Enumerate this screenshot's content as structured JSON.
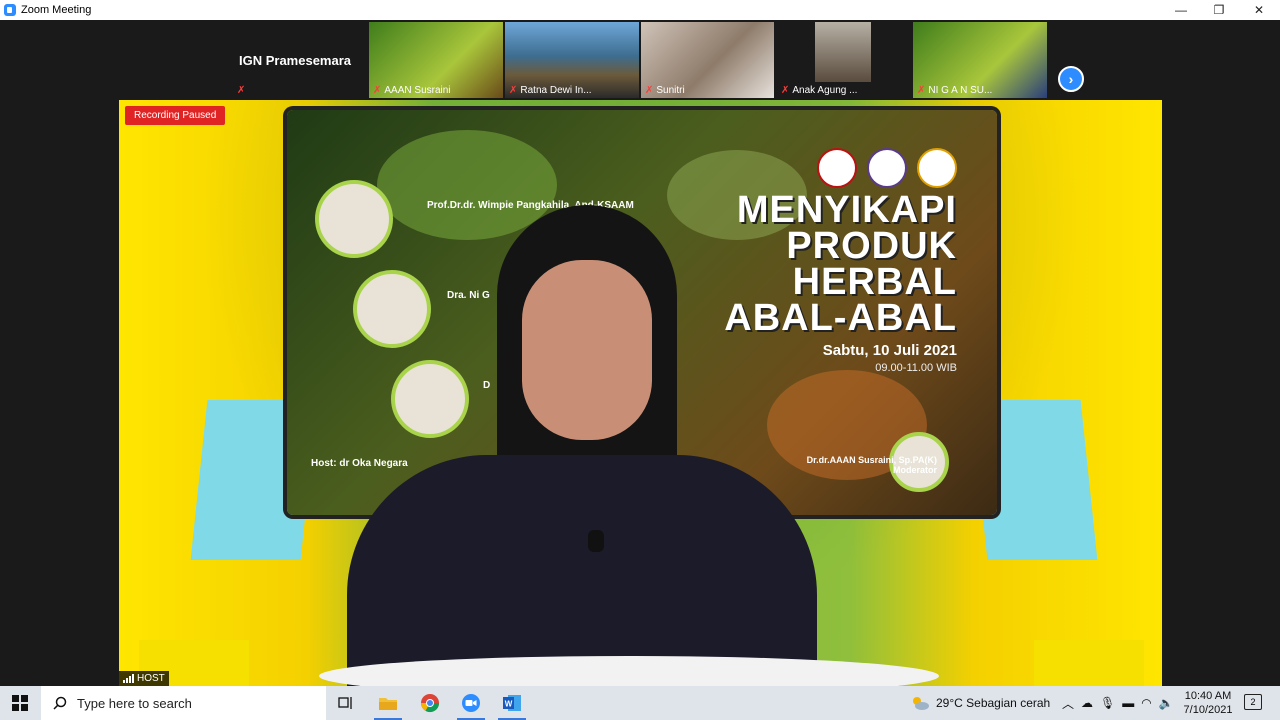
{
  "window": {
    "title": "Zoom Meeting"
  },
  "gallery": {
    "named_tile": {
      "name": "IGN Pramesemara"
    },
    "tiles": [
      {
        "name": "AAAN Susraini"
      },
      {
        "name": "Ratna Dewi In..."
      },
      {
        "name": "Sunitri"
      },
      {
        "name": "Anak Agung ..."
      },
      {
        "name": "NI  G A N  SU..."
      }
    ],
    "next_label": "›"
  },
  "main_video": {
    "recording_status": "Recording Paused",
    "host_label": "HOST",
    "banner": {
      "headline_lines": [
        "MENYIKAPI",
        "PRODUK",
        "HERBAL",
        "ABAL-ABAL"
      ],
      "date": "Sabtu, 10 Juli 2021",
      "time": "09.00-11.00 WIB",
      "speaker1": "Prof.Dr.dr. Wimpie Pangkahila, And-KSAAM",
      "speaker2": "Dra. Ni G",
      "speaker3": "D",
      "host": "Host: dr Oka Negara",
      "moderator_name": "Dr.dr.AAAN Susraini, Sp.PA(K)",
      "moderator_role": "Moderator"
    }
  },
  "taskbar": {
    "search_placeholder": "Type here to search",
    "weather": "29°C  Sebagian cerah",
    "time": "10:40 AM",
    "date": "7/10/2021",
    "notification_count": "2"
  }
}
